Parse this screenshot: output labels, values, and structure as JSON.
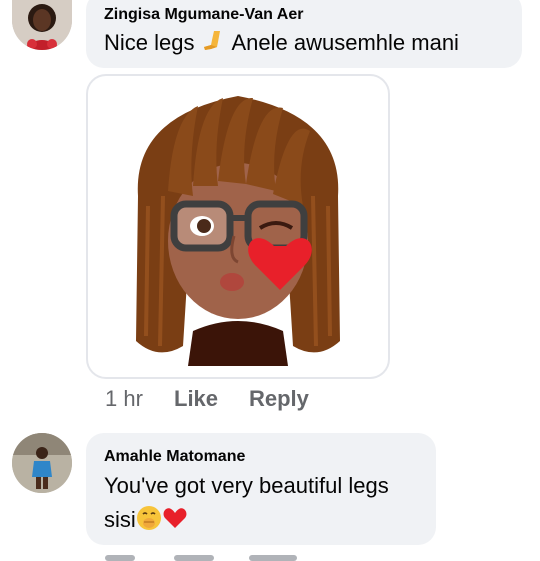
{
  "comments": [
    {
      "author": "Zingisa Mgumane-Van Aer",
      "text_before": "Nice legs ",
      "text_after": " Anele awusemhle mani",
      "leg_emoji_icon": "leg-emoji-icon",
      "sticker_icon": "memoji-wink-kiss-sticker",
      "timestamp": "1 hr",
      "like_label": "Like",
      "reply_label": "Reply"
    },
    {
      "author": "Amahle Matomane",
      "line1": "You've got very beautiful legs",
      "line2": "sisi",
      "emojis": [
        "face-with-hand-over-mouth-emoji-icon",
        "red-heart-emoji-icon"
      ]
    }
  ],
  "colors": {
    "bubble_bg": "#f0f2f5",
    "action_text": "#65676b",
    "heart_red": "#e8202a"
  }
}
